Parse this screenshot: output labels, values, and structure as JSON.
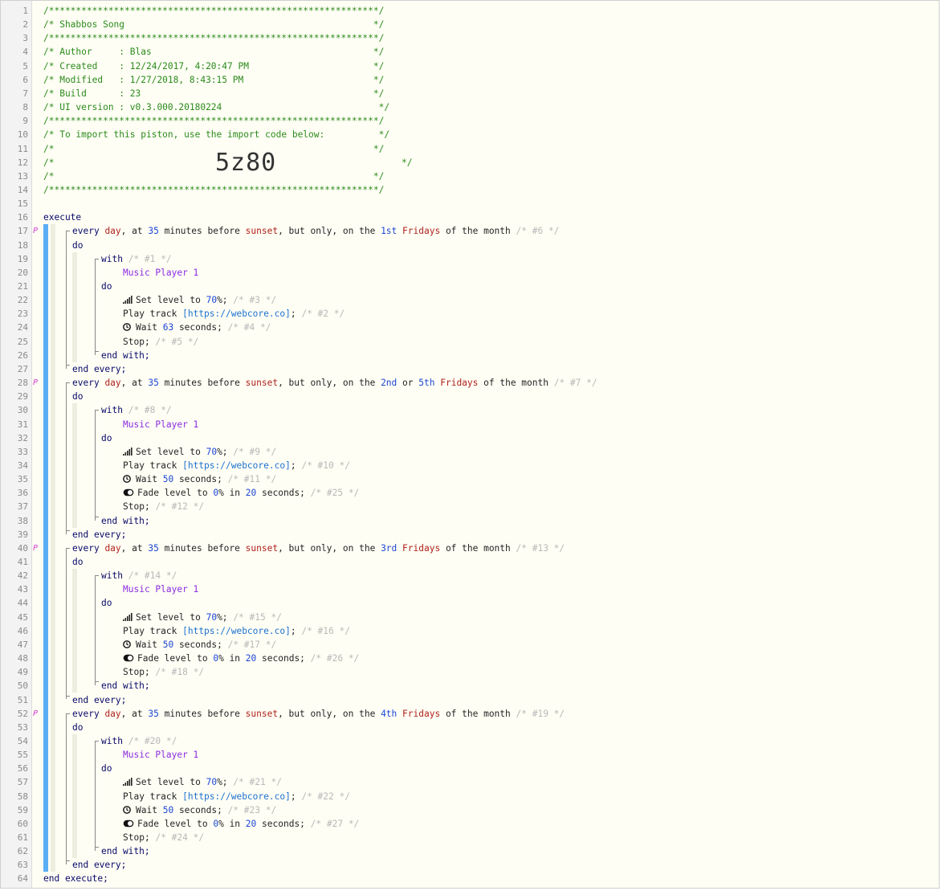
{
  "header": {
    "border": "/*************************************************************/",
    "title_line": "/* Shabbos Song                                              */",
    "author_line": "/* Author     : Blas                                         */",
    "created_line": "/* Created    : 12/24/2017, 4:20:47 PM                       */",
    "modified_line": "/* Modified   : 1/27/2018, 8:43:15 PM                        */",
    "build_line": "/* Build      : 23                                           */",
    "ui_line": "/* UI version : v0.3.000.20180224                             */",
    "import_line": "/* To import this piston, use the import code below:          */",
    "blank_line": "/*                                                           */",
    "code_prefix": "/*",
    "code_suffix": "*/",
    "import_code": "5z80"
  },
  "line_numbers": [
    "1",
    "2",
    "3",
    "4",
    "5",
    "6",
    "7",
    "8",
    "9",
    "10",
    "11",
    "12",
    "13",
    "14",
    "15",
    "16",
    "17",
    "18",
    "19",
    "20",
    "21",
    "22",
    "23",
    "24",
    "25",
    "26",
    "27",
    "28",
    "29",
    "30",
    "31",
    "32",
    "33",
    "34",
    "35",
    "36",
    "37",
    "38",
    "39",
    "40",
    "41",
    "42",
    "43",
    "44",
    "45",
    "46",
    "47",
    "48",
    "49",
    "50",
    "51",
    "52",
    "53",
    "54",
    "55",
    "56",
    "57",
    "58",
    "59",
    "60",
    "61",
    "62",
    "63",
    "64"
  ],
  "keywords": {
    "execute": "execute",
    "end_execute": "end execute;",
    "do": "do",
    "with": "with",
    "end_with": "end with;",
    "end_every": "end every;",
    "every": "every",
    "day": "day",
    "at": ", at",
    "minutes_before": "minutes before",
    "sunset": "sunset",
    "but_only": ", but only, on the",
    "of_month": "of the month",
    "fridays": "Fridays",
    "or": "or",
    "device": "Music Player 1",
    "set_level": "Set level to",
    "play_track": "Play track",
    "url": "[https://webcore.co]",
    "wait": "Wait",
    "seconds": "seconds;",
    "fade": "Fade level to",
    "in": "in",
    "stop": "Stop;",
    "pct70": "70",
    "pct0": "0",
    "pct_suffix": "%;",
    "pct_mid": "%",
    "semi": ";",
    "p_mark": "P"
  },
  "blocks": [
    {
      "minutes": "35",
      "ordinals": [
        "1st"
      ],
      "every_id": "/* #6 */",
      "with_id": "/* #1 */",
      "set_id": "/* #3 */",
      "play_id": "/* #2 */",
      "wait": "63",
      "wait_id": "/* #4 */",
      "fade": false,
      "stop_id": "/* #5 */"
    },
    {
      "minutes": "35",
      "ordinals": [
        "2nd",
        "5th"
      ],
      "every_id": "/* #7 */",
      "with_id": "/* #8 */",
      "set_id": "/* #9 */",
      "play_id": "/* #10 */",
      "wait": "50",
      "wait_id": "/* #11 */",
      "fade": true,
      "fade_secs": "20",
      "fade_id": "/* #25 */",
      "stop_id": "/* #12 */"
    },
    {
      "minutes": "35",
      "ordinals": [
        "3rd"
      ],
      "every_id": "/* #13 */",
      "with_id": "/* #14 */",
      "set_id": "/* #15 */",
      "play_id": "/* #16 */",
      "wait": "50",
      "wait_id": "/* #17 */",
      "fade": true,
      "fade_secs": "20",
      "fade_id": "/* #26 */",
      "stop_id": "/* #18 */"
    },
    {
      "minutes": "35",
      "ordinals": [
        "4th"
      ],
      "every_id": "/* #19 */",
      "with_id": "/* #20 */",
      "set_id": "/* #21 */",
      "play_id": "/* #22 */",
      "wait": "50",
      "wait_id": "/* #23 */",
      "fade": true,
      "fade_secs": "20",
      "fade_id": "/* #27 */",
      "stop_id": "/* #24 */"
    }
  ],
  "icons": {
    "signal": "signal-bars-icon",
    "clock": "clock-icon",
    "toggle": "toggle-icon"
  },
  "colors": {
    "keyword": "#07076a",
    "number": "#1d46d6",
    "value": "#b0211c",
    "device": "#8a2be2",
    "link": "#1e72d0",
    "comment": "#b8b8b8",
    "header_comment": "#2c8a1c",
    "bar": "#5aaef5"
  }
}
